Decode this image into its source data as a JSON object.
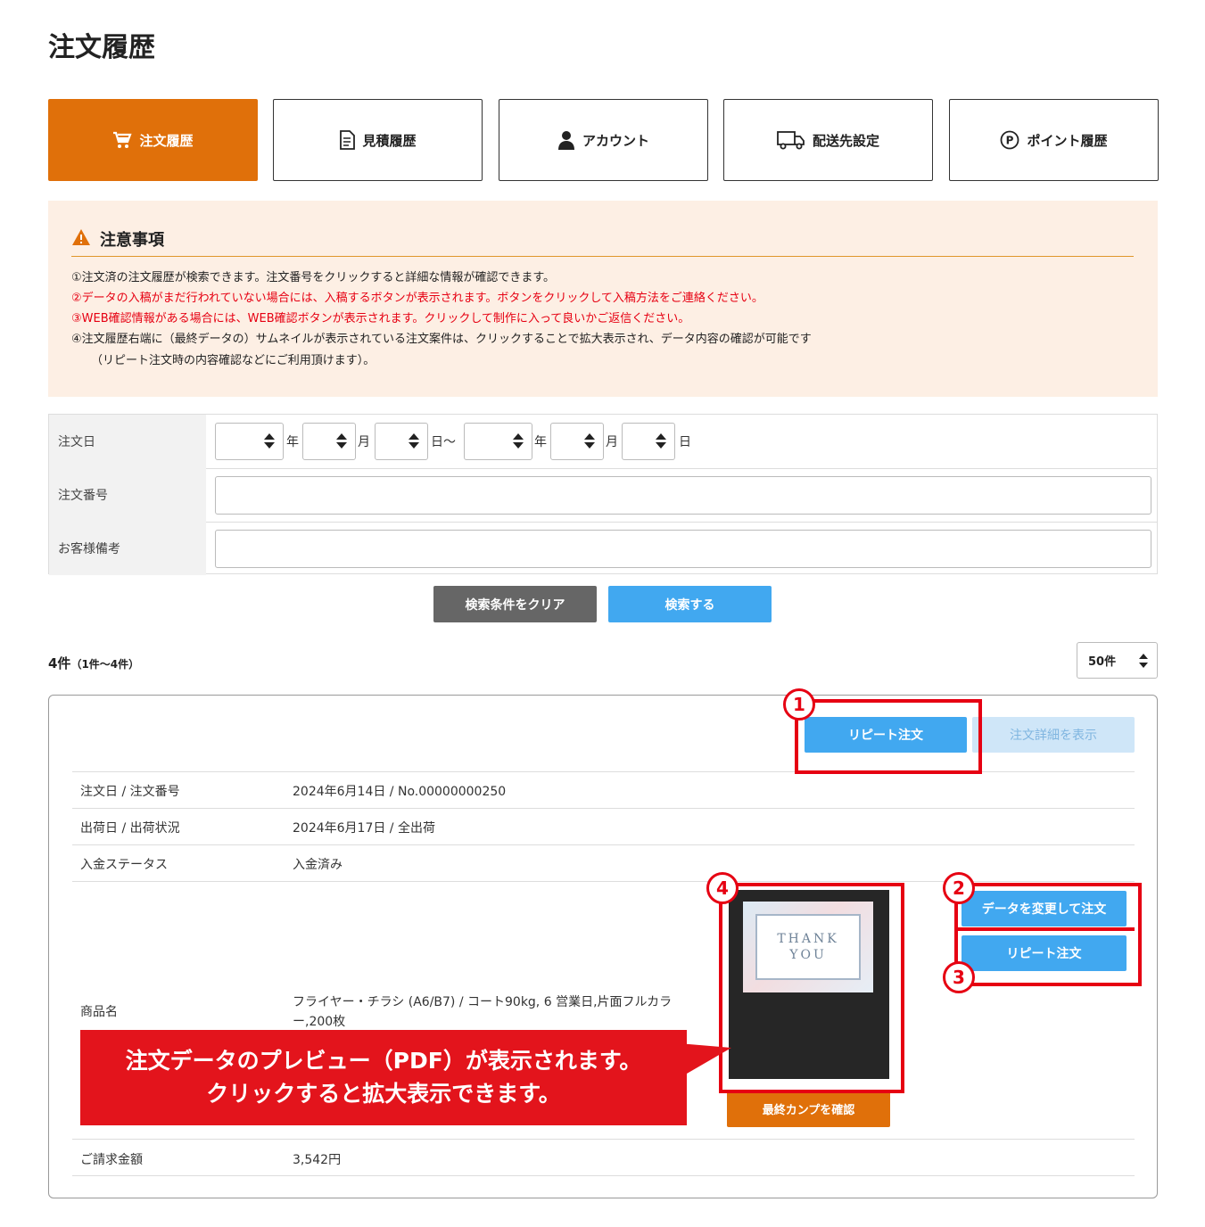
{
  "page": {
    "title": "注文履歴"
  },
  "tabs": [
    {
      "label": "注文履歴",
      "icon": "cart-icon",
      "active": true
    },
    {
      "label": "見積履歴",
      "icon": "document-icon",
      "active": false
    },
    {
      "label": "アカウント",
      "icon": "person-icon",
      "active": false
    },
    {
      "label": "配送先設定",
      "icon": "truck-icon",
      "active": false
    },
    {
      "label": "ポイント履歴",
      "icon": "point-icon",
      "active": false
    }
  ],
  "notice": {
    "title": "注意事項",
    "items": [
      "①注文済の注文履歴が検索できます。注文番号をクリックすると詳細な情報が確認できます。",
      "②データの入稿がまだ行われていない場合には、入稿するボタンが表示されます。ボタンをクリックして入稿方法をご連絡ください。",
      "③WEB確認情報がある場合には、WEB確認ボタンが表示されます。クリックして制作に入って良いかご返信ください。",
      "④注文履歴右端に（最終データの）サムネイルが表示されている注文案件は、クリックすることで拡大表示され、データ内容の確認が可能です",
      "（リピート注文時の内容確認などにご利用頂けます）。"
    ]
  },
  "search": {
    "date_label": "注文日",
    "units": {
      "year": "年",
      "month": "月",
      "day": "日",
      "range": "日〜"
    },
    "order_no_label": "注文番号",
    "note_label": "お客様備考",
    "clear_button": "検索条件をクリア",
    "search_button": "検索する"
  },
  "results": {
    "count": "4件",
    "range": "（1件〜4件）",
    "per_page": "50件"
  },
  "order": {
    "repeat_button_top": "リピート注文",
    "detail_button": "注文詳細を表示",
    "rows": {
      "order_label": "注文日 / 注文番号",
      "order_value": "2024年6月14日 / No.00000000250",
      "ship_label": "出荷日 / 出荷状況",
      "ship_value": "2024年6月17日 / 全出荷",
      "payment_label": "入金ステータス",
      "payment_value": "入金済み",
      "product_label": "商品名",
      "product_value_1": "フライヤー・チラシ (A6/B7) / コート90kg, 6 営業日,片面フルカラ",
      "product_value_2": "ー,200枚",
      "total_label": "ご請求金額",
      "total_value": "3,542円"
    },
    "thumbnail_text_1": "THANK",
    "thumbnail_text_2": "YOU",
    "final_proof_button": "最終カンプを確認",
    "change_data_button": "データを変更して注文",
    "repeat_button": "リピート注文"
  },
  "annotations": {
    "num1": "1",
    "num2": "2",
    "num3": "3",
    "num4": "4",
    "callout_line1": "注文データのプレビュー（PDF）が表示されます。",
    "callout_line2": "クリックすると拡大表示できます。"
  },
  "colors": {
    "accent_orange": "#e0700a",
    "button_blue": "#41a8f0",
    "button_light_blue": "#cfe6f8",
    "button_gray": "#666666",
    "annotation_red": "#e60012",
    "notice_bg": "#fdefe4"
  }
}
